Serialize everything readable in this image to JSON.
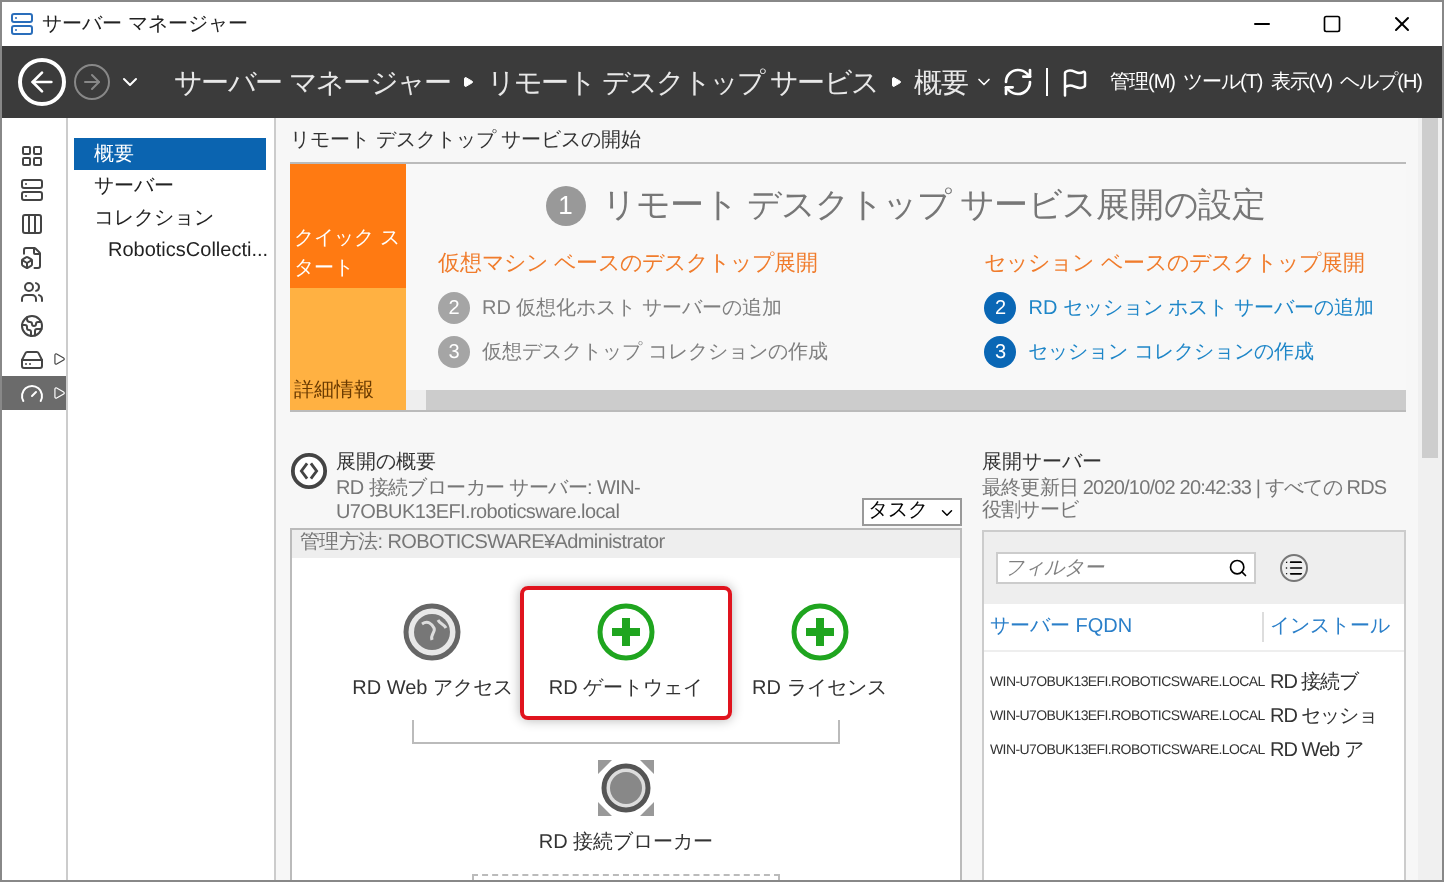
{
  "window": {
    "title": "サーバー マネージャー"
  },
  "header": {
    "breadcrumbs": [
      "サーバー マネージャー",
      "リモート デスクトップ サービス",
      "概要"
    ],
    "menu": [
      "管理(M)",
      "ツール(T)",
      "表示(V)",
      "ヘルプ(H)"
    ]
  },
  "rail": [
    {
      "kind": "dashboard",
      "selected": false,
      "expandable": false
    },
    {
      "kind": "server",
      "selected": false,
      "expandable": false
    },
    {
      "kind": "servers",
      "selected": false,
      "expandable": false
    },
    {
      "kind": "file",
      "selected": false,
      "expandable": false
    },
    {
      "kind": "users",
      "selected": false,
      "expandable": false
    },
    {
      "kind": "iis",
      "selected": false,
      "expandable": false
    },
    {
      "kind": "storage",
      "selected": false,
      "expandable": true
    },
    {
      "kind": "rds",
      "selected": true,
      "expandable": true
    }
  ],
  "nav": [
    {
      "label": "概要",
      "selected": true
    },
    {
      "label": "サーバー",
      "selected": false
    },
    {
      "label": "コレクション",
      "selected": false,
      "children": [
        {
          "label": "RoboticsCollecti...",
          "selected": false
        }
      ]
    }
  ],
  "quick_start": {
    "heading": "リモート デスクトップ サービスの開始",
    "tiles": [
      {
        "label": "クイック スタート",
        "selected": true
      },
      {
        "label": "詳細情報",
        "selected": false
      }
    ],
    "step_number": "1",
    "title": "リモート デスクトップ サービス展開の設定",
    "columns": [
      {
        "heading": "仮想マシン ベースのデスクトップ展開",
        "steps": [
          {
            "number": "2",
            "label": "RD 仮想化ホスト サーバーの追加",
            "enabled": false
          },
          {
            "number": "3",
            "label": "仮想デスクトップ コレクションの作成",
            "enabled": false
          }
        ]
      },
      {
        "heading": "セッション ベースのデスクトップ展開",
        "steps": [
          {
            "number": "2",
            "label": "RD セッション ホスト サーバーの追加",
            "enabled": true
          },
          {
            "number": "3",
            "label": "セッション コレクションの作成",
            "enabled": true
          }
        ]
      }
    ]
  },
  "overview": {
    "title": "展開の概要",
    "subtitle": "RD 接続ブローカー サーバー: WIN-U7OBUK13EFI.roboticsware.local",
    "tasks_button": "タスク",
    "managed_by": "管理方法: ROBOTICSWARE¥Administrator",
    "nodes": [
      {
        "kind": "web",
        "label": "RD Web アクセス",
        "highlighted": false
      },
      {
        "kind": "add",
        "label": "RD ゲートウェイ",
        "highlighted": true
      },
      {
        "kind": "add",
        "label": "RD ライセンス",
        "highlighted": false
      }
    ],
    "broker": {
      "kind": "broker",
      "label": "RD 接続ブローカー"
    }
  },
  "servers": {
    "title": "展開サーバー",
    "subtitle": "最終更新日 2020/10/02 20:42:33 | すべての RDS 役割サービ",
    "filter": {
      "placeholder": "フィルター"
    },
    "columns": [
      "サーバー FQDN",
      "インストール"
    ],
    "rows": [
      [
        "WIN-U7OBUK13EFI.ROBOTICSWARE.LOCAL",
        "RD 接続ブ"
      ],
      [
        "WIN-U7OBUK13EFI.ROBOTICSWARE.LOCAL",
        "RD セッショ"
      ],
      [
        "WIN-U7OBUK13EFI.ROBOTICSWARE.LOCAL",
        "RD Web ア"
      ]
    ]
  }
}
